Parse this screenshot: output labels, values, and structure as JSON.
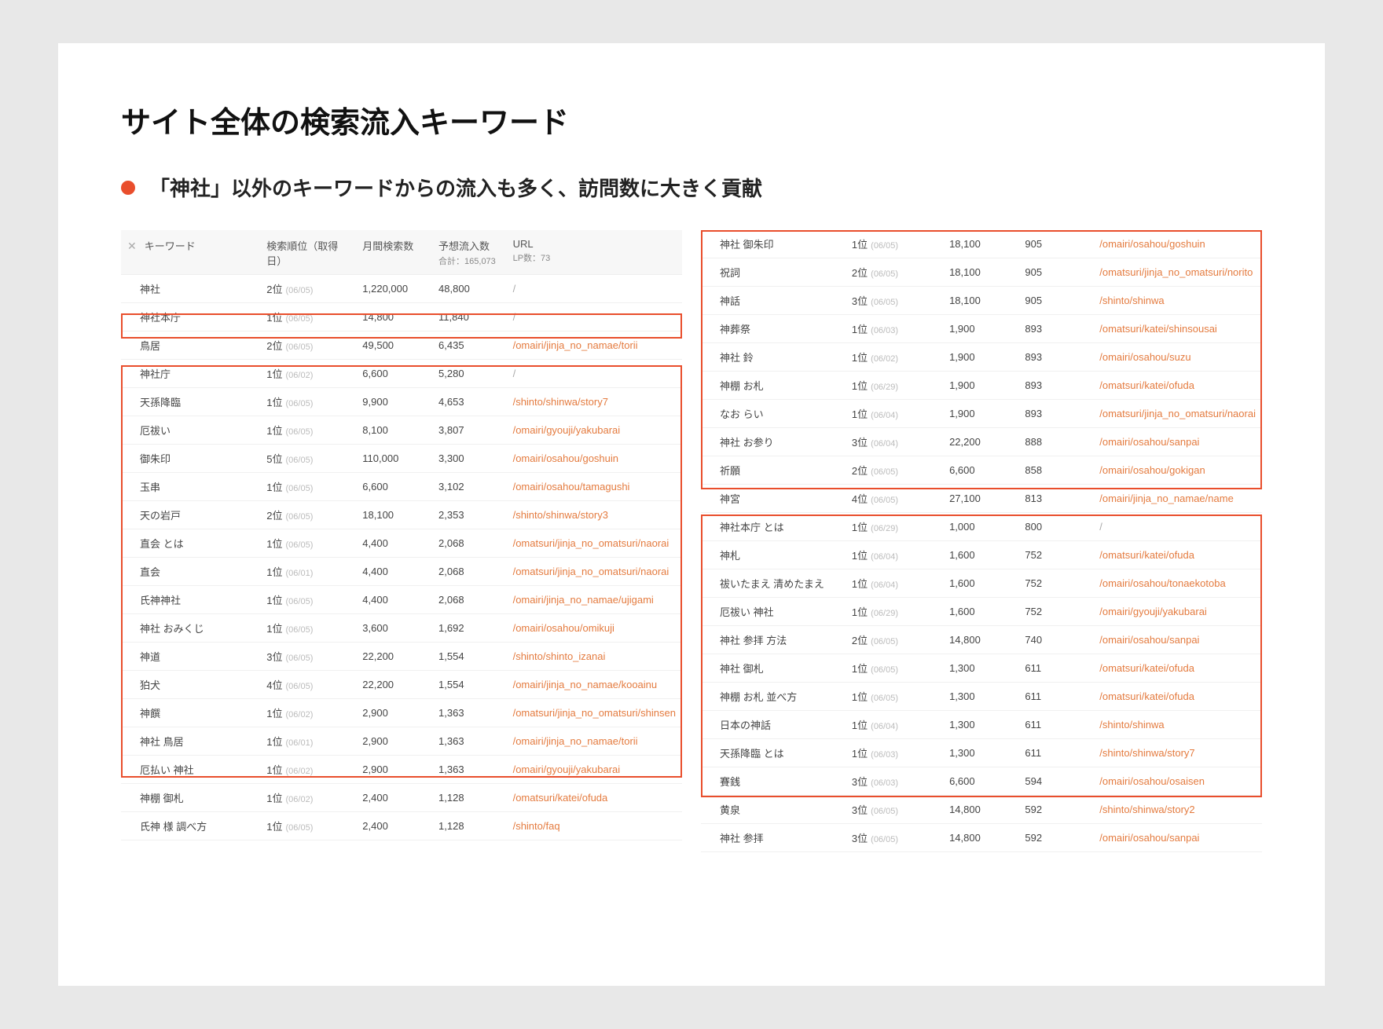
{
  "title": "サイト全体の検索流入キーワード",
  "bullet": "「神社」以外のキーワードからの流入も多く、訪問数に大きく貢献",
  "columns": {
    "keyword": "キーワード",
    "rank": "検索順位（取得日）",
    "volume": "月間検索数",
    "est": "予想流入数",
    "est_sub": "合計：165,073",
    "url": "URL",
    "url_sub": "LP数：73"
  },
  "left_rows": [
    {
      "kw": "神社",
      "rank": "2位",
      "date": "(06/05)",
      "vol": "1,220,000",
      "est": "48,800",
      "url": "/"
    },
    {
      "kw": "神社本庁",
      "rank": "1位",
      "date": "(06/05)",
      "vol": "14,800",
      "est": "11,840",
      "url": "/"
    },
    {
      "kw": "鳥居",
      "rank": "2位",
      "date": "(06/05)",
      "vol": "49,500",
      "est": "6,435",
      "url": "/omairi/jinja_no_namae/torii"
    },
    {
      "kw": "神社庁",
      "rank": "1位",
      "date": "(06/02)",
      "vol": "6,600",
      "est": "5,280",
      "url": "/"
    },
    {
      "kw": "天孫降臨",
      "rank": "1位",
      "date": "(06/05)",
      "vol": "9,900",
      "est": "4,653",
      "url": "/shinto/shinwa/story7"
    },
    {
      "kw": "厄祓い",
      "rank": "1位",
      "date": "(06/05)",
      "vol": "8,100",
      "est": "3,807",
      "url": "/omairi/gyouji/yakubarai"
    },
    {
      "kw": "御朱印",
      "rank": "5位",
      "date": "(06/05)",
      "vol": "110,000",
      "est": "3,300",
      "url": "/omairi/osahou/goshuin"
    },
    {
      "kw": "玉串",
      "rank": "1位",
      "date": "(06/05)",
      "vol": "6,600",
      "est": "3,102",
      "url": "/omairi/osahou/tamagushi"
    },
    {
      "kw": "天の岩戸",
      "rank": "2位",
      "date": "(06/05)",
      "vol": "18,100",
      "est": "2,353",
      "url": "/shinto/shinwa/story3"
    },
    {
      "kw": "直会 とは",
      "rank": "1位",
      "date": "(06/05)",
      "vol": "4,400",
      "est": "2,068",
      "url": "/omatsuri/jinja_no_omatsuri/naorai"
    },
    {
      "kw": "直会",
      "rank": "1位",
      "date": "(06/01)",
      "vol": "4,400",
      "est": "2,068",
      "url": "/omatsuri/jinja_no_omatsuri/naorai"
    },
    {
      "kw": "氏神神社",
      "rank": "1位",
      "date": "(06/05)",
      "vol": "4,400",
      "est": "2,068",
      "url": "/omairi/jinja_no_namae/ujigami"
    },
    {
      "kw": "神社 おみくじ",
      "rank": "1位",
      "date": "(06/05)",
      "vol": "3,600",
      "est": "1,692",
      "url": "/omairi/osahou/omikuji"
    },
    {
      "kw": "神道",
      "rank": "3位",
      "date": "(06/05)",
      "vol": "22,200",
      "est": "1,554",
      "url": "/shinto/shinto_izanai"
    },
    {
      "kw": "狛犬",
      "rank": "4位",
      "date": "(06/05)",
      "vol": "22,200",
      "est": "1,554",
      "url": "/omairi/jinja_no_namae/kooainu"
    },
    {
      "kw": "神饌",
      "rank": "1位",
      "date": "(06/02)",
      "vol": "2,900",
      "est": "1,363",
      "url": "/omatsuri/jinja_no_omatsuri/shinsen"
    },
    {
      "kw": "神社 鳥居",
      "rank": "1位",
      "date": "(06/01)",
      "vol": "2,900",
      "est": "1,363",
      "url": "/omairi/jinja_no_namae/torii"
    },
    {
      "kw": "厄払い 神社",
      "rank": "1位",
      "date": "(06/02)",
      "vol": "2,900",
      "est": "1,363",
      "url": "/omairi/gyouji/yakubarai"
    },
    {
      "kw": "神棚 御札",
      "rank": "1位",
      "date": "(06/02)",
      "vol": "2,400",
      "est": "1,128",
      "url": "/omatsuri/katei/ofuda"
    },
    {
      "kw": "氏神 様 調べ方",
      "rank": "1位",
      "date": "(06/05)",
      "vol": "2,400",
      "est": "1,128",
      "url": "/shinto/faq"
    }
  ],
  "right_rows": [
    {
      "kw": "神社 御朱印",
      "rank": "1位",
      "date": "(06/05)",
      "vol": "18,100",
      "est": "905",
      "url": "/omairi/osahou/goshuin"
    },
    {
      "kw": "祝詞",
      "rank": "2位",
      "date": "(06/05)",
      "vol": "18,100",
      "est": "905",
      "url": "/omatsuri/jinja_no_omatsuri/norito"
    },
    {
      "kw": "神話",
      "rank": "3位",
      "date": "(06/05)",
      "vol": "18,100",
      "est": "905",
      "url": "/shinto/shinwa"
    },
    {
      "kw": "神葬祭",
      "rank": "1位",
      "date": "(06/03)",
      "vol": "1,900",
      "est": "893",
      "url": "/omatsuri/katei/shinsousai"
    },
    {
      "kw": "神社 鈴",
      "rank": "1位",
      "date": "(06/02)",
      "vol": "1,900",
      "est": "893",
      "url": "/omairi/osahou/suzu"
    },
    {
      "kw": "神棚 お札",
      "rank": "1位",
      "date": "(06/29)",
      "vol": "1,900",
      "est": "893",
      "url": "/omatsuri/katei/ofuda"
    },
    {
      "kw": "なお らい",
      "rank": "1位",
      "date": "(06/04)",
      "vol": "1,900",
      "est": "893",
      "url": "/omatsuri/jinja_no_omatsuri/naorai"
    },
    {
      "kw": "神社 お参り",
      "rank": "3位",
      "date": "(06/04)",
      "vol": "22,200",
      "est": "888",
      "url": "/omairi/osahou/sanpai"
    },
    {
      "kw": "祈願",
      "rank": "2位",
      "date": "(06/05)",
      "vol": "6,600",
      "est": "858",
      "url": "/omairi/osahou/gokigan"
    },
    {
      "kw": "神宮",
      "rank": "4位",
      "date": "(06/05)",
      "vol": "27,100",
      "est": "813",
      "url": "/omairi/jinja_no_namae/name"
    },
    {
      "kw": "神社本庁 とは",
      "rank": "1位",
      "date": "(06/29)",
      "vol": "1,000",
      "est": "800",
      "url": "/"
    },
    {
      "kw": "神札",
      "rank": "1位",
      "date": "(06/04)",
      "vol": "1,600",
      "est": "752",
      "url": "/omatsuri/katei/ofuda"
    },
    {
      "kw": "祓いたまえ 清めたまえ",
      "rank": "1位",
      "date": "(06/04)",
      "vol": "1,600",
      "est": "752",
      "url": "/omairi/osahou/tonaekotoba"
    },
    {
      "kw": "厄祓い 神社",
      "rank": "1位",
      "date": "(06/29)",
      "vol": "1,600",
      "est": "752",
      "url": "/omairi/gyouji/yakubarai"
    },
    {
      "kw": "神社 参拝 方法",
      "rank": "2位",
      "date": "(06/05)",
      "vol": "14,800",
      "est": "740",
      "url": "/omairi/osahou/sanpai"
    },
    {
      "kw": "神社 御札",
      "rank": "1位",
      "date": "(06/05)",
      "vol": "1,300",
      "est": "611",
      "url": "/omatsuri/katei/ofuda"
    },
    {
      "kw": "神棚 お札 並べ方",
      "rank": "1位",
      "date": "(06/05)",
      "vol": "1,300",
      "est": "611",
      "url": "/omatsuri/katei/ofuda"
    },
    {
      "kw": "日本の神話",
      "rank": "1位",
      "date": "(06/04)",
      "vol": "1,300",
      "est": "611",
      "url": "/shinto/shinwa"
    },
    {
      "kw": "天孫降臨 とは",
      "rank": "1位",
      "date": "(06/03)",
      "vol": "1,300",
      "est": "611",
      "url": "/shinto/shinwa/story7"
    },
    {
      "kw": "賽銭",
      "rank": "3位",
      "date": "(06/03)",
      "vol": "6,600",
      "est": "594",
      "url": "/omairi/osahou/osaisen"
    },
    {
      "kw": "黄泉",
      "rank": "3位",
      "date": "(06/05)",
      "vol": "14,800",
      "est": "592",
      "url": "/shinto/shinwa/story2"
    },
    {
      "kw": "神社 参拝",
      "rank": "3位",
      "date": "(06/05)",
      "vol": "14,800",
      "est": "592",
      "url": "/omairi/osahou/sanpai"
    }
  ]
}
